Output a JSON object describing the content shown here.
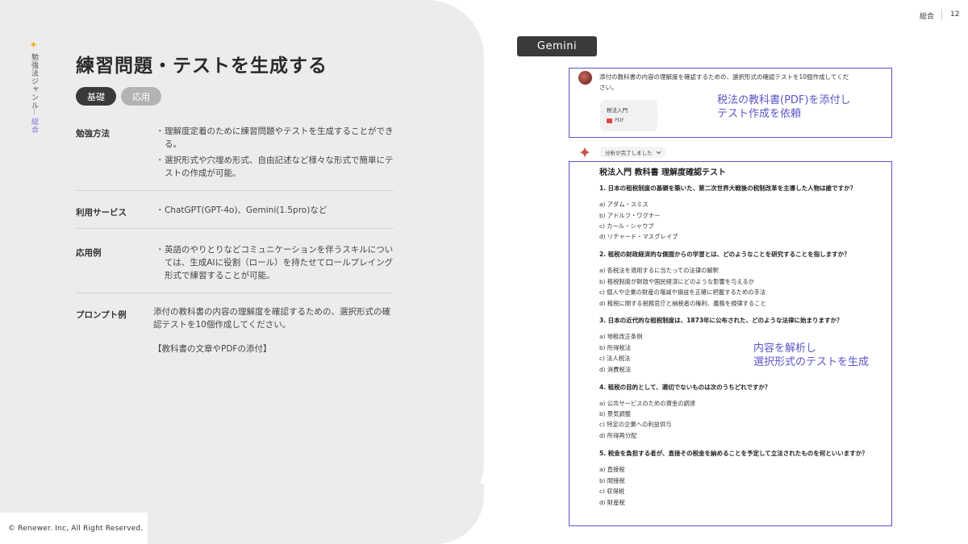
{
  "side": {
    "category_label": "勉強法ジャンル",
    "current": "総合"
  },
  "title": "練習問題・テストを生成する",
  "pills": {
    "basic": "基礎",
    "applied": "応用"
  },
  "rows": {
    "method": {
      "label": "勉強方法",
      "bullets": [
        "理解度定着のために練習問題やテストを生成することができ",
        "る。",
        "選択形式や穴埋め形式、自由記述など様々な形式で簡単にテ",
        "ストの作成が可能。"
      ]
    },
    "service": {
      "label": "利用サービス",
      "text": "ChatGPT(GPT-4o)、Gemini(1.5pro)など"
    },
    "example": {
      "label": "応用例",
      "lines": [
        "英語のやりとりなどコミュニケーションを伴うスキルについ",
        "ては、生成AIに役割（ロール）を持たせてロールプレイング",
        "形式で練習することが可能。"
      ]
    },
    "prompt": {
      "label": "プロンプト例",
      "lines": [
        "添付の教科書の内容の理解度を確認するための、選択形式の確",
        "認テストを10個作成してください。"
      ],
      "note": "【教科書の文章やPDFの添付】"
    }
  },
  "copyright": "© Renewer. Inc, All Right Reserved.",
  "top_right": {
    "label": "総合",
    "page": "12"
  },
  "gemini": {
    "badge": "Gemini",
    "prompt_lines": [
      "添付の教科書の内容の理解度を確認するための、選択形式の確認テストを10個作成してくだ",
      "さい。"
    ],
    "file": {
      "name": "税法入門",
      "type": "PDF"
    },
    "annotation1": [
      "税法の教科書(PDF)を添付し",
      "テスト作成を依頼"
    ],
    "analysis_chip": "分析が完了しました",
    "annotation2": [
      "内容を解析し",
      "選択形式のテストを生成"
    ],
    "quiz": {
      "title": "税法入門 教科書 理解度確認テスト",
      "questions": [
        {
          "q": "1. 日本の租税制度の基礎を築いた、第二次世界大戦後の税制改革を主導した人物は誰ですか？",
          "options": [
            "a) アダム・スミス",
            "b) アドルフ・ワグナー",
            "c) カール・シャウプ",
            "d) リチャード・マスグレイブ"
          ]
        },
        {
          "q": "2. 租税の財政経済的な側面からの学習とは、どのようなことを研究することを指しますか？",
          "options": [
            "a) 各税法を適用するに当たっての法律の解釈",
            "b) 租税制度が財政や国民経済にどのような影響を与えるか",
            "c) 個人や企業の財産の増減や損益を正確に把握するための手法",
            "d) 租税に関する税務官庁と納税者の権利、義務を規律すること"
          ]
        },
        {
          "q": "3. 日本の近代的な租税制度は、1873年に公布された、どのような法律に始まりますか？",
          "options": [
            "a) 地租改正条例",
            "b) 所得税法",
            "c) 法人税法",
            "d) 消費税法"
          ]
        },
        {
          "q": "4. 租税の目的として、適切でないものは次のうちどれですか？",
          "options": [
            "a) 公共サービスのための資金の調達",
            "b) 景気調整",
            "c) 特定の企業への利益供与",
            "d) 所得再分配"
          ]
        },
        {
          "q": "5. 税金を負担する者が、直接その税金を納めることを予定して立法されたものを何といいますか？",
          "options": [
            "a) 直接税",
            "b) 間接税",
            "c) 収得税",
            "d) 財産税"
          ]
        }
      ]
    }
  },
  "colors": {
    "accent": "#5a55c8",
    "star": "#f2b233",
    "dark": "#3a3a3a",
    "panel": "#ececec"
  }
}
